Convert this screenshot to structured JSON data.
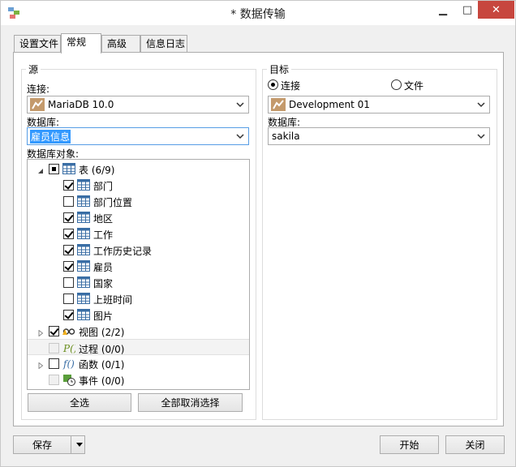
{
  "window": {
    "title": "* 数据传输"
  },
  "titlebar_buttons": {
    "minimize": "▁",
    "maximize": "□",
    "close": "✕"
  },
  "tabs": [
    {
      "label": "设置文件",
      "active": false
    },
    {
      "label": "常规",
      "active": true
    },
    {
      "label": "高级",
      "active": false
    },
    {
      "label": "信息日志",
      "active": false
    }
  ],
  "source": {
    "title": "源",
    "connection_label": "连接:",
    "connection_value": "MariaDB 10.0",
    "database_label": "数据库:",
    "database_value": "雇员信息",
    "objects_label": "数据库对象:",
    "tree": [
      {
        "label": "表",
        "count": "(6/9)",
        "icon": "table-icon",
        "state": "partial",
        "expander": "expanded-arrow-icon"
      },
      {
        "label": "部门",
        "icon": "table-icon",
        "state": "checked"
      },
      {
        "label": "部门位置",
        "icon": "table-icon",
        "state": "unchecked"
      },
      {
        "label": "地区",
        "icon": "table-icon",
        "state": "checked"
      },
      {
        "label": "工作",
        "icon": "table-icon",
        "state": "checked"
      },
      {
        "label": "工作历史记录",
        "icon": "table-icon",
        "state": "checked"
      },
      {
        "label": "雇员",
        "icon": "table-icon",
        "state": "checked"
      },
      {
        "label": "国家",
        "icon": "table-icon",
        "state": "unchecked"
      },
      {
        "label": "上班时间",
        "icon": "table-icon",
        "state": "unchecked"
      },
      {
        "label": "图片",
        "icon": "table-icon",
        "state": "checked"
      },
      {
        "label": "视图",
        "count": "(2/2)",
        "icon": "view-glasses-icon",
        "state": "checked",
        "expander": "collapsed-arrow-icon"
      },
      {
        "label": "过程",
        "count": "(0/0)",
        "icon": "procedure-icon",
        "state": "disabled",
        "highlighted": true
      },
      {
        "label": "函数",
        "count": "(0/1)",
        "icon": "function-icon",
        "state": "unchecked",
        "expander": "collapsed-arrow-icon"
      },
      {
        "label": "事件",
        "count": "(0/0)",
        "icon": "event-clock-icon",
        "state": "disabled"
      }
    ],
    "select_all": "全选",
    "deselect_all": "全部取消选择"
  },
  "target": {
    "title": "目标",
    "radio_connection": "连接",
    "radio_file": "文件",
    "connection_value": "Development 01",
    "database_label": "数据库:",
    "database_value": "sakila"
  },
  "footer": {
    "save": "保存",
    "start": "开始",
    "close": "关闭"
  },
  "colors": {
    "selection": "#3399ff",
    "close_button": "#c7463e",
    "focus_border": "#569de5"
  }
}
